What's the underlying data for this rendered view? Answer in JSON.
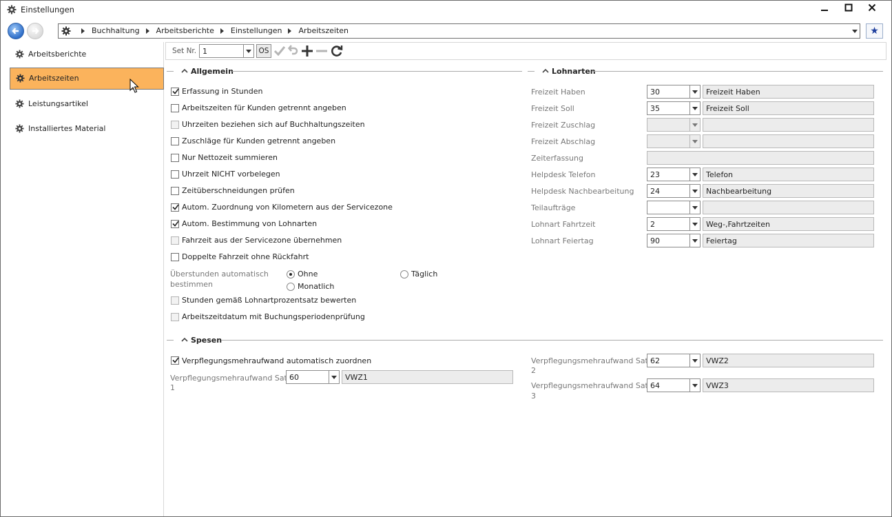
{
  "window": {
    "title": "Einstellungen"
  },
  "breadcrumb": [
    "Buchhaltung",
    "Arbeitsberichte",
    "Einstellungen",
    "Arbeitszeiten"
  ],
  "sidebar": {
    "items": [
      {
        "label": "Arbeitsberichte"
      },
      {
        "label": "Arbeitszeiten"
      },
      {
        "label": "Leistungsartikel"
      },
      {
        "label": "Installiertes Material"
      }
    ]
  },
  "toolbar": {
    "set_label": "Set Nr.",
    "set_value": "1",
    "os_label": "OS"
  },
  "allgemein": {
    "title": "Allgemein",
    "checkboxes": [
      {
        "label": "Erfassung in Stunden",
        "checked": true
      },
      {
        "label": "Arbeitszeiten für Kunden getrennt angeben",
        "checked": false
      },
      {
        "label": "Uhrzeiten beziehen sich auf Buchhaltungszeiten",
        "checked": false,
        "disabled": true
      },
      {
        "label": "Zuschläge für Kunden getrennt angeben",
        "checked": false
      },
      {
        "label": "Nur Nettozeit summieren",
        "checked": false
      },
      {
        "label": "Uhrzeit NICHT vorbelegen",
        "checked": false
      },
      {
        "label": "Zeitüberschneidungen prüfen",
        "checked": false
      },
      {
        "label": "Autom. Zuordnung von Kilometern aus der Servicezone",
        "checked": true
      },
      {
        "label": "Autom. Bestimmung von Lohnarten",
        "checked": true
      },
      {
        "label": "Fahrzeit aus der Servicezone übernehmen",
        "checked": false,
        "disabled": true
      },
      {
        "label": "Doppelte Fahrzeit ohne Rückfahrt",
        "checked": false
      }
    ],
    "ueberstunden": {
      "label_line1": "Überstunden automatisch",
      "label_line2": "bestimmen",
      "options": [
        "Ohne",
        "Monatlich",
        "Täglich"
      ],
      "selected": "Ohne"
    },
    "checkboxes2": [
      {
        "label": "Stunden gemäß Lohnartprozentsatz bewerten",
        "checked": false,
        "disabled": true
      },
      {
        "label": "Arbeitszeitdatum mit Buchungsperiodenprüfung",
        "checked": false,
        "disabled": true
      }
    ]
  },
  "lohnarten": {
    "title": "Lohnarten",
    "rows": [
      {
        "label": "Freizeit Haben",
        "code": "30",
        "text": "Freizeit Haben"
      },
      {
        "label": "Freizeit Soll",
        "code": "35",
        "text": "Freizeit Soll"
      },
      {
        "label": "Freizeit Zuschlag",
        "code": "",
        "text": ""
      },
      {
        "label": "Freizeit Abschlag",
        "code": "",
        "text": ""
      },
      {
        "label": "Zeiterfassung",
        "code": "",
        "text": ""
      },
      {
        "label": "Helpdesk Telefon",
        "code": "23",
        "text": "Telefon"
      },
      {
        "label": "Helpdesk Nachbearbeitung",
        "code": "24",
        "text": "Nachbearbeitung"
      },
      {
        "label": "Teilaufträge",
        "code": "",
        "text": ""
      },
      {
        "label": "Lohnart Fahrtzeit",
        "code": "2",
        "text": "Weg-,Fahrtzeiten"
      },
      {
        "label": "Lohnart Feiertag",
        "code": "90",
        "text": "Feiertag"
      }
    ]
  },
  "spesen": {
    "title": "Spesen",
    "auto_label": "Verpflegungsmehraufwand automatisch zuordnen",
    "satz1": {
      "label_line1": "Verpflegungsmehraufwand Satz",
      "label_line2": "1",
      "code": "60",
      "text": "VWZ1"
    },
    "satz2": {
      "label_line1": "Verpflegungsmehraufwand Satz",
      "label_line2": "2",
      "code": "62",
      "text": "VWZ2"
    },
    "satz3": {
      "label_line1": "Verpflegungsmehraufwand Satz",
      "label_line2": "3",
      "code": "64",
      "text": "VWZ3"
    }
  }
}
